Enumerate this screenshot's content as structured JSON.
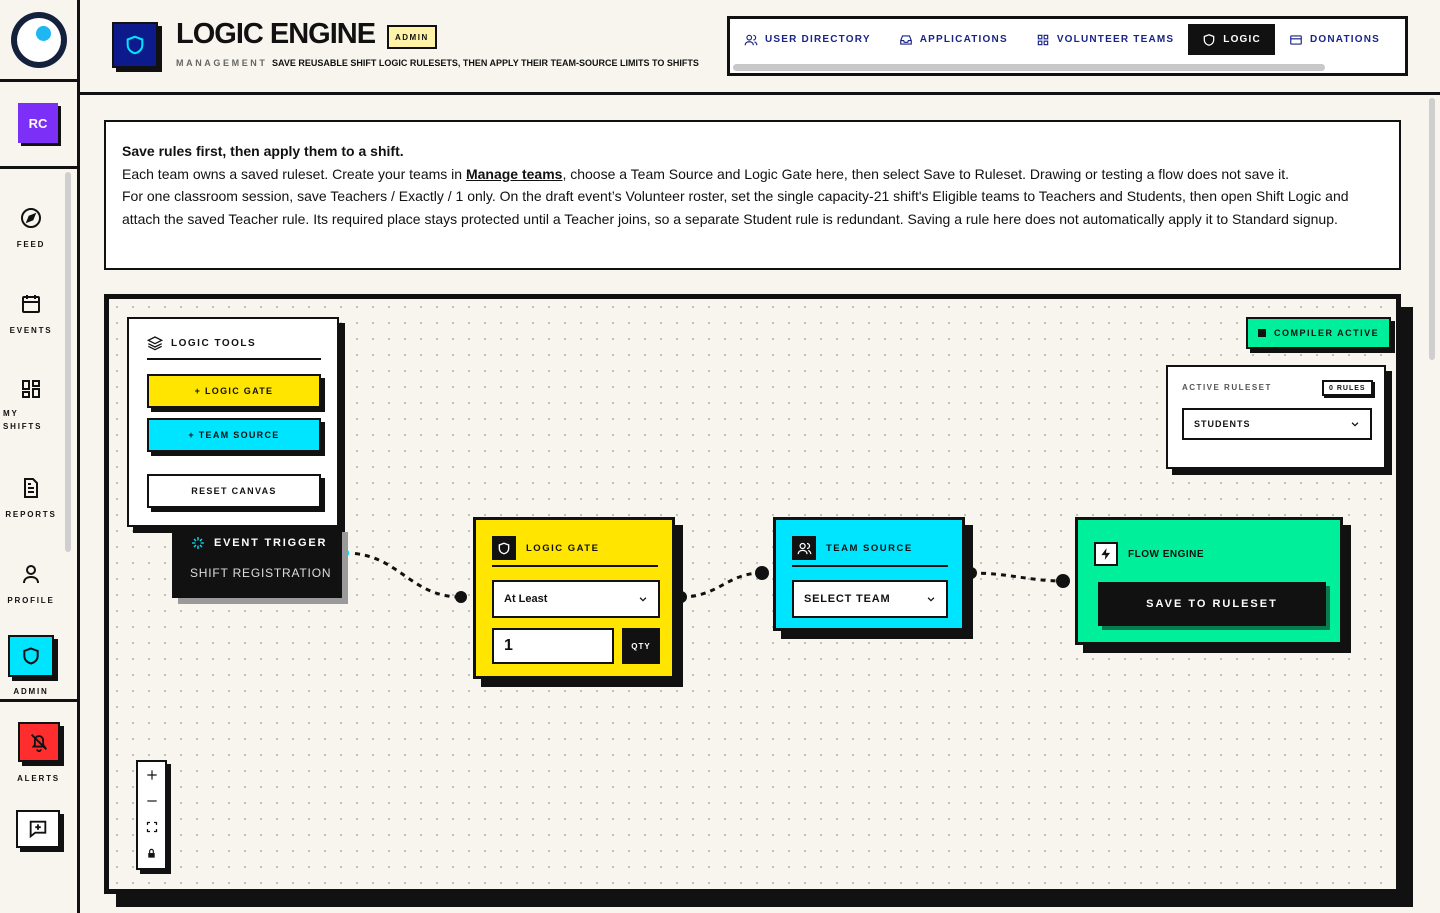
{
  "sidebar": {
    "avatar_initials": "RC",
    "items": [
      {
        "label": "FEED"
      },
      {
        "label": "EVENTS"
      },
      {
        "label": "MY SHIFTS"
      },
      {
        "label": "REPORTS"
      },
      {
        "label": "PROFILE"
      },
      {
        "label": "ADMIN"
      }
    ],
    "alerts_label": "ALERTS"
  },
  "header": {
    "title": "LOGIC ENGINE",
    "badge": "ADMIN",
    "subtitle": "MANAGEMENT",
    "description": "SAVE REUSABLE SHIFT LOGIC RULESETS, THEN APPLY THEIR TEAM-SOURCE LIMITS TO SHIFTS",
    "tabs": [
      {
        "label": "USER DIRECTORY",
        "icon": "users-icon"
      },
      {
        "label": "APPLICATIONS",
        "icon": "inbox-icon"
      },
      {
        "label": "VOLUNTEER TEAMS",
        "icon": "grid-icon"
      },
      {
        "label": "LOGIC",
        "icon": "shield-icon",
        "active": true
      },
      {
        "label": "DONATIONS",
        "icon": "card-icon"
      }
    ]
  },
  "info": {
    "heading": "Save rules first, then apply them to a shift.",
    "line1_pre": "Each team owns a saved ruleset. Create your teams in ",
    "line1_link": "Manage teams",
    "line1_post": ", choose a Team Source and Logic Gate here, then select Save to Ruleset. Drawing or testing a flow does not save it.",
    "line2": "For one classroom session, save Teachers / Exactly / 1 only. On the draft event’s Volunteer roster, set the single capacity-21 shift's Eligible teams to Teachers and Students, then open Shift Logic and attach the saved Teacher rule. Its required place stays protected until a Teacher joins, so a separate Student rule is redundant. Saving a rule here does not automatically apply it to Standard signup."
  },
  "canvas": {
    "tools": {
      "title": "LOGIC TOOLS",
      "logic_gate_btn": "+ LOGIC GATE",
      "team_source_btn": "+ TEAM SOURCE",
      "reset_btn": "RESET CANVAS"
    },
    "trigger": {
      "title": "EVENT TRIGGER",
      "subtitle": "SHIFT REGISTRATION"
    },
    "gate": {
      "title": "LOGIC GATE",
      "operator": "At Least",
      "quantity": "1",
      "qty_label": "QTY"
    },
    "team": {
      "title": "TEAM SOURCE",
      "select": "SELECT TEAM"
    },
    "flow": {
      "title": "FLOW ENGINE",
      "save_btn": "SAVE TO RULESET"
    },
    "compiler_badge": "COMPILER ACTIVE",
    "ruleset": {
      "label": "ACTIVE RULESET",
      "count": "0 RULES",
      "selected": "STUDENTS"
    }
  },
  "colors": {
    "yellow": "#ffe500",
    "cyan": "#00e5ff",
    "green": "#00ef9a",
    "navy": "#0d1a8c",
    "purple": "#7b2ff7",
    "red": "#ff2d2d"
  }
}
